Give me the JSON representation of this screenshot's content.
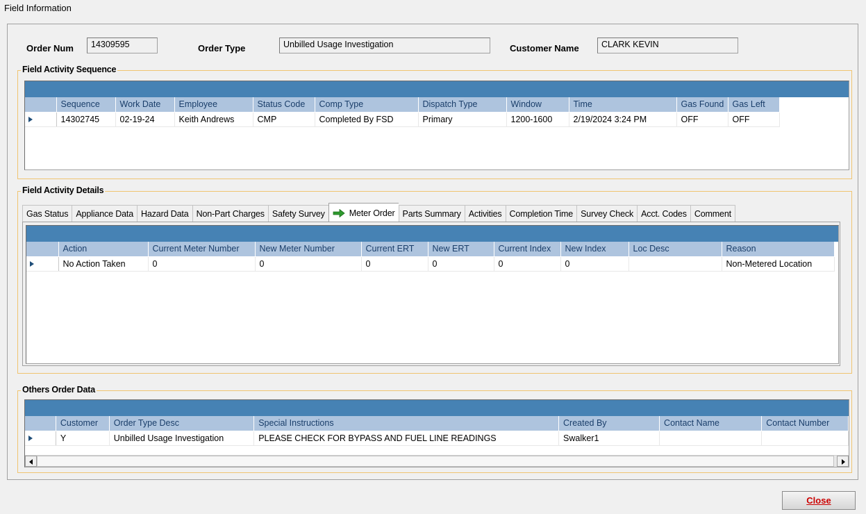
{
  "window": {
    "title": "Field Information"
  },
  "header": {
    "order_num_label": "Order Num",
    "order_num_value": "14309595",
    "order_type_label": "Order Type",
    "order_type_value": "Unbilled Usage Investigation",
    "customer_name_label": "Customer Name",
    "customer_name_value": "CLARK KEVIN"
  },
  "sequence": {
    "title": "Field Activity Sequence",
    "columns": [
      "Sequence",
      "Work Date",
      "Employee",
      "Status Code",
      "Comp Type",
      "Dispatch Type",
      "Window",
      "Time",
      "Gas Found",
      "Gas Left"
    ],
    "rows": [
      [
        "14302745",
        "02-19-24",
        "Keith Andrews",
        "CMP",
        "Completed By FSD",
        "Primary",
        "1200-1600",
        "2/19/2024 3:24 PM",
        "OFF",
        "OFF"
      ]
    ]
  },
  "details": {
    "title": "Field Activity Details",
    "tabs": [
      "Gas Status",
      "Appliance Data",
      "Hazard Data",
      "Non-Part Charges",
      "Safety Survey",
      "Meter Order",
      "Parts Summary",
      "Activities",
      "Completion Time",
      "Survey Check",
      "Acct. Codes",
      "Comment"
    ],
    "active_tab": "Meter Order",
    "columns": [
      "Action",
      "Current Meter Number",
      "New Meter Number",
      "Current ERT",
      "New ERT",
      "Current Index",
      "New Index",
      "Loc Desc",
      "Reason"
    ],
    "rows": [
      [
        "No Action Taken",
        "0",
        "0",
        "0",
        "0",
        "0",
        "0",
        "",
        "Non-Metered Location"
      ]
    ]
  },
  "others": {
    "title": "Others Order Data",
    "columns": [
      "Customer",
      "Order Type Desc",
      "Special Instructions",
      "Created By",
      "Contact Name",
      "Contact Number"
    ],
    "rows": [
      [
        "Y",
        "Unbilled Usage Investigation",
        "PLEASE CHECK FOR BYPASS AND FUEL LINE READINGS",
        "Swalker1",
        "",
        ""
      ]
    ]
  },
  "buttons": {
    "close": "Close"
  },
  "colors": {
    "grid_band": "#4682b4",
    "header_bg": "#aec4de",
    "group_border": "#f0c470",
    "close_text": "#cc0000",
    "active_tab_arrow": "#2e9a2e"
  },
  "icons": {
    "active_tab": "green-arrow-icon",
    "row_pointer": "row-pointer-icon"
  }
}
